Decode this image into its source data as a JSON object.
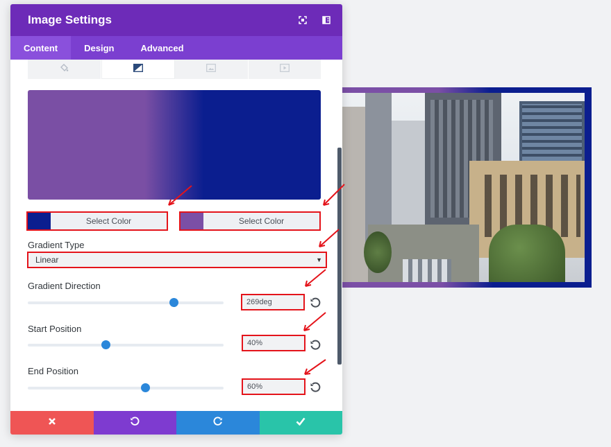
{
  "panel": {
    "title": "Image Settings",
    "header_icons": [
      "screenshot-icon",
      "split-view-icon"
    ],
    "tabs": [
      {
        "label": "Content",
        "active": true
      },
      {
        "label": "Design",
        "active": false
      },
      {
        "label": "Advanced",
        "active": false
      }
    ],
    "background_subtabs": [
      {
        "icon": "paint-bucket-icon",
        "active": false
      },
      {
        "icon": "gradient-icon",
        "active": true
      },
      {
        "icon": "image-icon",
        "active": false
      },
      {
        "icon": "video-icon",
        "active": false
      }
    ]
  },
  "gradient": {
    "start_color": "#0b1e8f",
    "end_color": "#7b4fa6",
    "start_select_label": "Select Color",
    "end_select_label": "Select Color",
    "type_label": "Gradient Type",
    "type_value": "Linear",
    "direction_label": "Gradient Direction",
    "direction_value": "269deg",
    "direction_degrees": 269,
    "start_position_label": "Start Position",
    "start_position_value": "40%",
    "start_position": 0.4,
    "end_position_label": "End Position",
    "end_position_value": "60%",
    "end_position": 0.6
  },
  "footer": {
    "buttons": [
      {
        "icon": "close-icon",
        "color": "#ef5555"
      },
      {
        "icon": "undo-icon",
        "color": "#7e3bd0"
      },
      {
        "icon": "redo-icon",
        "color": "#2b87da"
      },
      {
        "icon": "check-icon",
        "color": "#29c4a9"
      }
    ]
  },
  "colors": {
    "header": "#6d2bb8",
    "tabs": "#7b3fd0",
    "highlight": "#e4131a",
    "slider_thumb": "#2b87da"
  }
}
